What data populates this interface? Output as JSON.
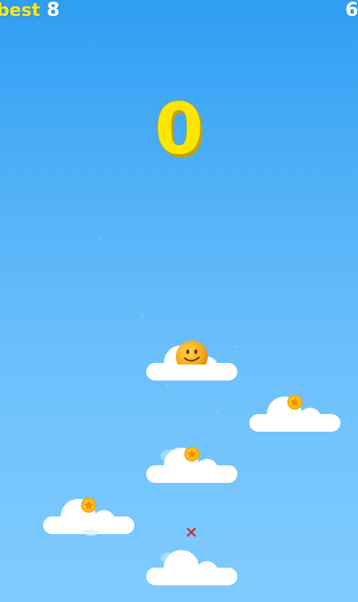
{
  "hud": {
    "best_label": "best",
    "best_value": "8",
    "coins_value": "6"
  },
  "score": "0",
  "icons": {
    "coin": "star-coin-icon",
    "player": "smiley-ball-icon",
    "landing_marker": "red-x-icon",
    "cloud": "cloud-platform"
  },
  "landing_marker_text": "✕",
  "colors": {
    "sky_top": "#2f9ef2",
    "sky_bottom": "#7fcbff",
    "score_yellow": "#ffe600",
    "best_yellow": "#ffe818",
    "coin_gold": "#f2a900",
    "marker_red": "#e01818"
  }
}
